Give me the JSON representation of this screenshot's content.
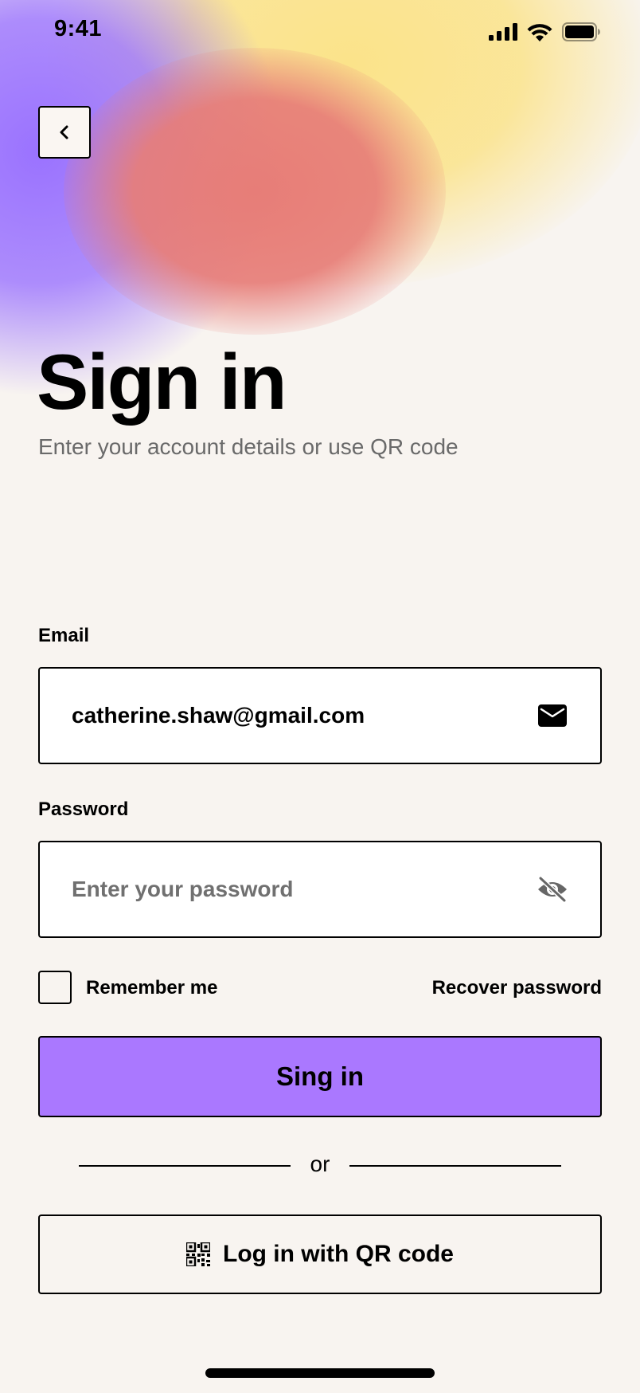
{
  "status_bar": {
    "time": "9:41",
    "icons": [
      "signal-icon",
      "wifi-icon",
      "battery-icon"
    ]
  },
  "header": {
    "back_icon": "chevron-left-icon",
    "title": "Sign in",
    "subtitle": "Enter your account details or use QR code"
  },
  "form": {
    "email_label": "Email",
    "email_value": "catherine.shaw@gmail.com",
    "email_icon": "mail-icon",
    "password_label": "Password",
    "password_placeholder": "Enter your password",
    "password_icon": "eye-off-icon",
    "remember_label": "Remember me",
    "remember_checked": false,
    "recover_label": "Recover password",
    "submit_label": "Sing in",
    "divider_text": "or",
    "qr_label": "Log in with QR code",
    "qr_icon": "qr-code-icon"
  },
  "colors": {
    "background": "#f8f4f0",
    "primary": "#aa78ff",
    "text": "#000000",
    "muted": "#6a6a6a"
  }
}
